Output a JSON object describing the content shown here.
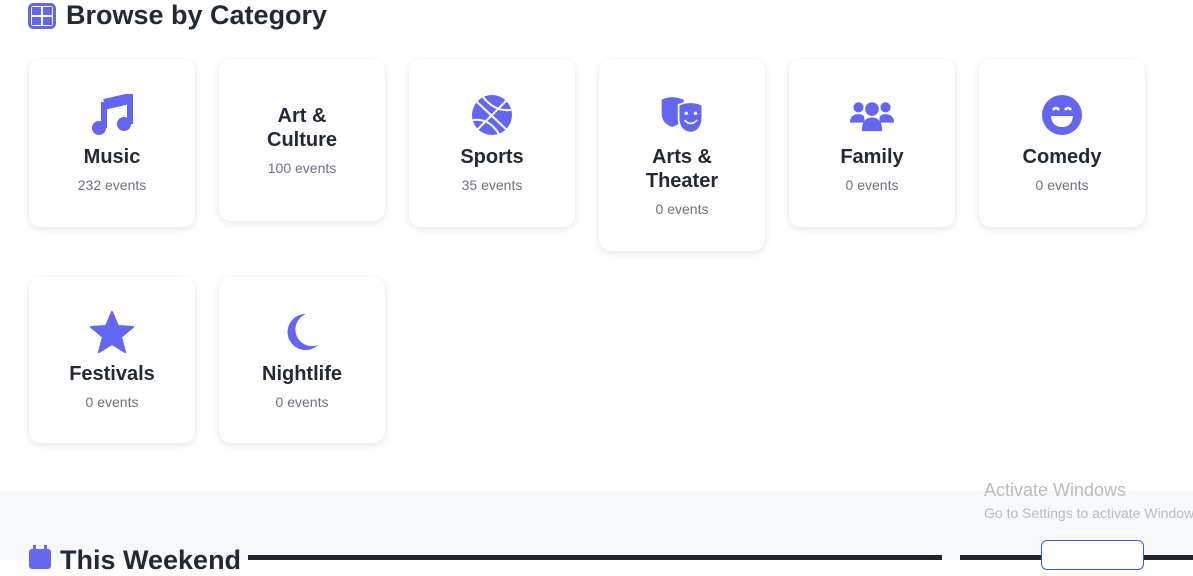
{
  "section_title": "Browse by Category",
  "accent": "#6366f1",
  "categories": [
    {
      "name": "Music",
      "count": "232 events",
      "icon": "music-icon"
    },
    {
      "name": "Art & Culture",
      "count": "100 events",
      "icon": ""
    },
    {
      "name": "Sports",
      "count": "35 events",
      "icon": "basketball-icon"
    },
    {
      "name": "Arts & Theater",
      "count": "0 events",
      "icon": "theater-masks-icon"
    },
    {
      "name": "Family",
      "count": "0 events",
      "icon": "users-icon"
    },
    {
      "name": "Comedy",
      "count": "0 events",
      "icon": "laugh-icon"
    },
    {
      "name": "Festivals",
      "count": "0 events",
      "icon": "star-icon"
    },
    {
      "name": "Nightlife",
      "count": "0 events",
      "icon": "moon-icon"
    }
  ],
  "next_section_title": "This Weekend",
  "watermark": {
    "line1": "Activate Windows",
    "line2": "Go to Settings to activate Windows."
  }
}
